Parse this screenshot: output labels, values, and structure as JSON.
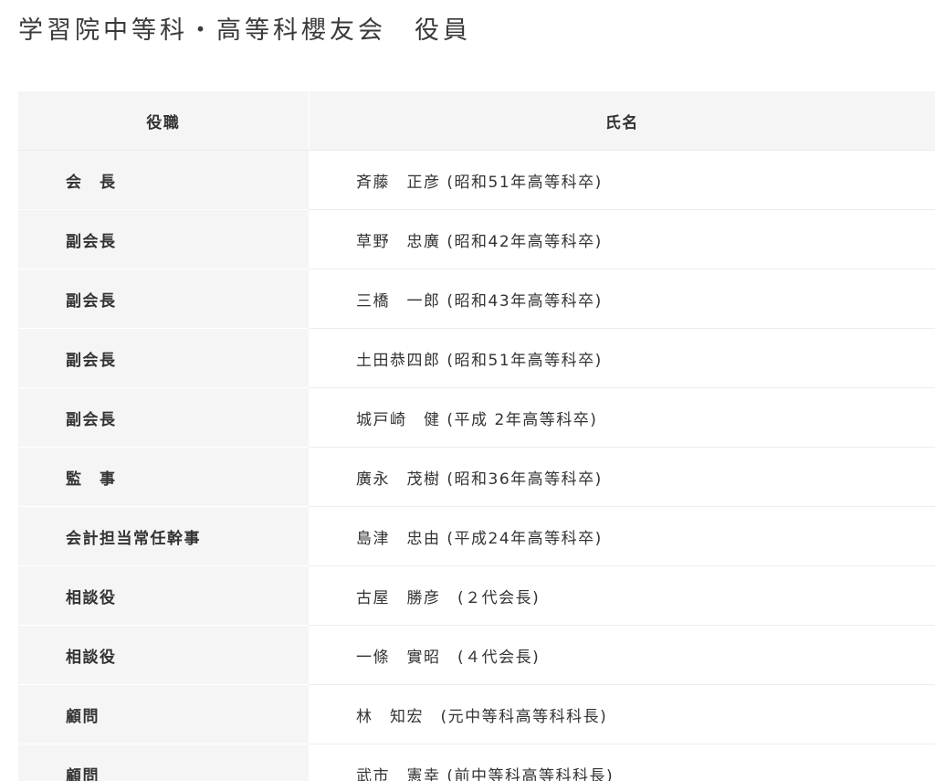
{
  "page": {
    "title": "学習院中等科・高等科櫻友会　役員"
  },
  "table": {
    "headers": {
      "role": "役職",
      "name": "氏名"
    },
    "rows": [
      {
        "role": "会　長",
        "name": "斉藤　正彦 (昭和51年高等科卒)"
      },
      {
        "role": "副会長",
        "name": "草野　忠廣 (昭和42年高等科卒)"
      },
      {
        "role": "副会長",
        "name": "三橋　一郎 (昭和43年高等科卒)"
      },
      {
        "role": "副会長",
        "name": "土田恭四郎 (昭和51年高等科卒)"
      },
      {
        "role": "副会長",
        "name": "城戸崎　健 (平成 2年高等科卒)"
      },
      {
        "role": "監　事",
        "name": "廣永　茂樹 (昭和36年高等科卒)"
      },
      {
        "role": "会計担当常任幹事",
        "name": "島津　忠由 (平成24年高等科卒)"
      },
      {
        "role": "相談役",
        "name": "古屋　勝彦　(２代会長)"
      },
      {
        "role": "相談役",
        "name": "一條　實昭　(４代会長)"
      },
      {
        "role": "顧問",
        "name": "林　知宏　(元中等科高等科科長)"
      },
      {
        "role": "顧問",
        "name": "武市　憲幸 (前中等科高等科科長)"
      }
    ]
  }
}
